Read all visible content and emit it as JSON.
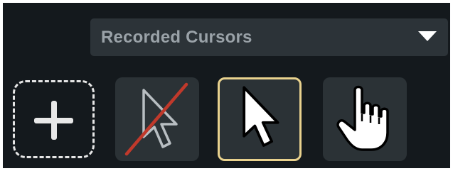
{
  "cursor_panel": {
    "dropdown": {
      "selected": "Recorded Cursors",
      "caret_icon": "caret-down-icon"
    },
    "add_tile": {
      "icon": "plus-icon"
    },
    "cursor_options": [
      {
        "name": "no-cursor",
        "icon": "hidden-cursor-icon",
        "selected": false
      },
      {
        "name": "arrow",
        "icon": "arrow-cursor-icon",
        "selected": true
      },
      {
        "name": "hand",
        "icon": "hand-cursor-icon",
        "selected": false
      }
    ],
    "colors": {
      "background": "#14191d",
      "tile": "#2b3236",
      "dropdown": "#2c3338",
      "selected_border": "#e9d28e",
      "strike": "#c0392b"
    }
  }
}
